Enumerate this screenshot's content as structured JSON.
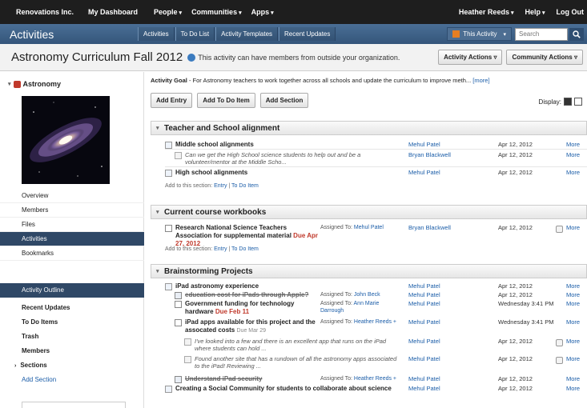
{
  "topnav": {
    "org": "Renovations Inc.",
    "dashboard": "My Dashboard",
    "people": "People",
    "communities": "Communities",
    "apps": "Apps",
    "user": "Heather Reeds",
    "help": "Help",
    "logout": "Log Out"
  },
  "subnav": {
    "section_title": "Activities",
    "tabs": [
      "Activities",
      "To Do List",
      "Activity Templates",
      "Recent Updates"
    ],
    "this_activity": "This Activity",
    "search_placeholder": "Search"
  },
  "title": {
    "name": "Astronomy Curriculum Fall 2012",
    "external_note": "This activity can have members from outside your organization.",
    "activity_actions": "Activity Actions",
    "community_actions": "Community Actions"
  },
  "sidebar": {
    "header": "Astronomy",
    "nav": [
      "Overview",
      "Members",
      "Files",
      "Activities",
      "Bookmarks"
    ],
    "active_nav": "Activities",
    "outline_header": "Activity Outline",
    "outline": [
      "Recent Updates",
      "To Do Items",
      "Trash",
      "Members",
      "Sections"
    ],
    "add_section": "Add Section"
  },
  "main": {
    "goal_label": "Activity Goal",
    "goal_text": " - For Astronomy teachers to work together across all schools and update the curriculum to improve meth...",
    "goal_more": "[more]",
    "buttons": {
      "add_entry": "Add Entry",
      "add_todo": "Add To Do Item",
      "add_section": "Add Section"
    },
    "display_label": "Display:",
    "add_to_label": "Add to this section:",
    "add_entry_link": "Entry",
    "add_todo_link": "To Do Item",
    "more": "More",
    "assigned_label": "Assigned To:"
  },
  "sections": [
    {
      "title": "Teacher and School alignment",
      "rows": [
        {
          "kind": "entry",
          "text": "Middle school alignments",
          "person": "Mehul Patel",
          "date": "Apr 12, 2012"
        },
        {
          "kind": "comment",
          "text": "Can we get the High School science students to help out and be a volunteer/mentor at the Middle Scho...",
          "person": "Bryan Blackwell",
          "date": "Apr 12, 2012"
        },
        {
          "kind": "entry",
          "text": "High school alignments",
          "person": "Mehul Patel",
          "date": "Apr 12, 2012"
        }
      ]
    },
    {
      "title": "Current course workbooks",
      "rows": [
        {
          "kind": "todo",
          "text": "Research National Science Teachers Association for supplemental material",
          "due": "Due Apr 27, 2012",
          "assigned": "Mehul Patel",
          "person": "Bryan Blackwell",
          "date": "Apr 12, 2012"
        }
      ]
    },
    {
      "title": "Brainstorming Projects",
      "rows": [
        {
          "kind": "entry",
          "text": "iPad astronomy experience",
          "person": "Mehul Patel",
          "date": "Apr 12, 2012"
        },
        {
          "kind": "done",
          "text": "education cost for iPads through Apple?",
          "assigned": "John Beck",
          "person": "Mehul Patel",
          "date": "Apr 12, 2012"
        },
        {
          "kind": "todo",
          "text": "Government funding for technology hardware",
          "due": "Due Feb 11",
          "assigned": "Ann Marie Darrough",
          "person": "Mehul Patel",
          "date": "Wednesday 3:41 PM"
        },
        {
          "kind": "todo",
          "text": "iPad apps available for this project and the assocated costs",
          "due_small": "Due Mar 29",
          "assigned": "Heather Reeds +",
          "person": "Mehul Patel",
          "date": "Wednesday 3:41 PM"
        },
        {
          "kind": "comment",
          "text": "I've looked into a few and there is an excellent app that runs on the iPad where students can hold ...",
          "person": "Mehul Patel",
          "date": "Apr 12, 2012"
        },
        {
          "kind": "comment",
          "text": "Found another site that has a rundown of all the astronomy apps associated to the iPad! Reviewing ...",
          "person": "Mehul Patel",
          "date": "Apr 12, 2012"
        },
        {
          "kind": "done",
          "text": "Understand iPad security",
          "assigned": "Heather Reeds +",
          "person": "Mehul Patel",
          "date": "Apr 12, 2012"
        },
        {
          "kind": "entry",
          "text": "Creating a Social Community for students to collaborate about science",
          "person": "Mehul Patel",
          "date": "Apr 12, 2012"
        }
      ]
    }
  ]
}
